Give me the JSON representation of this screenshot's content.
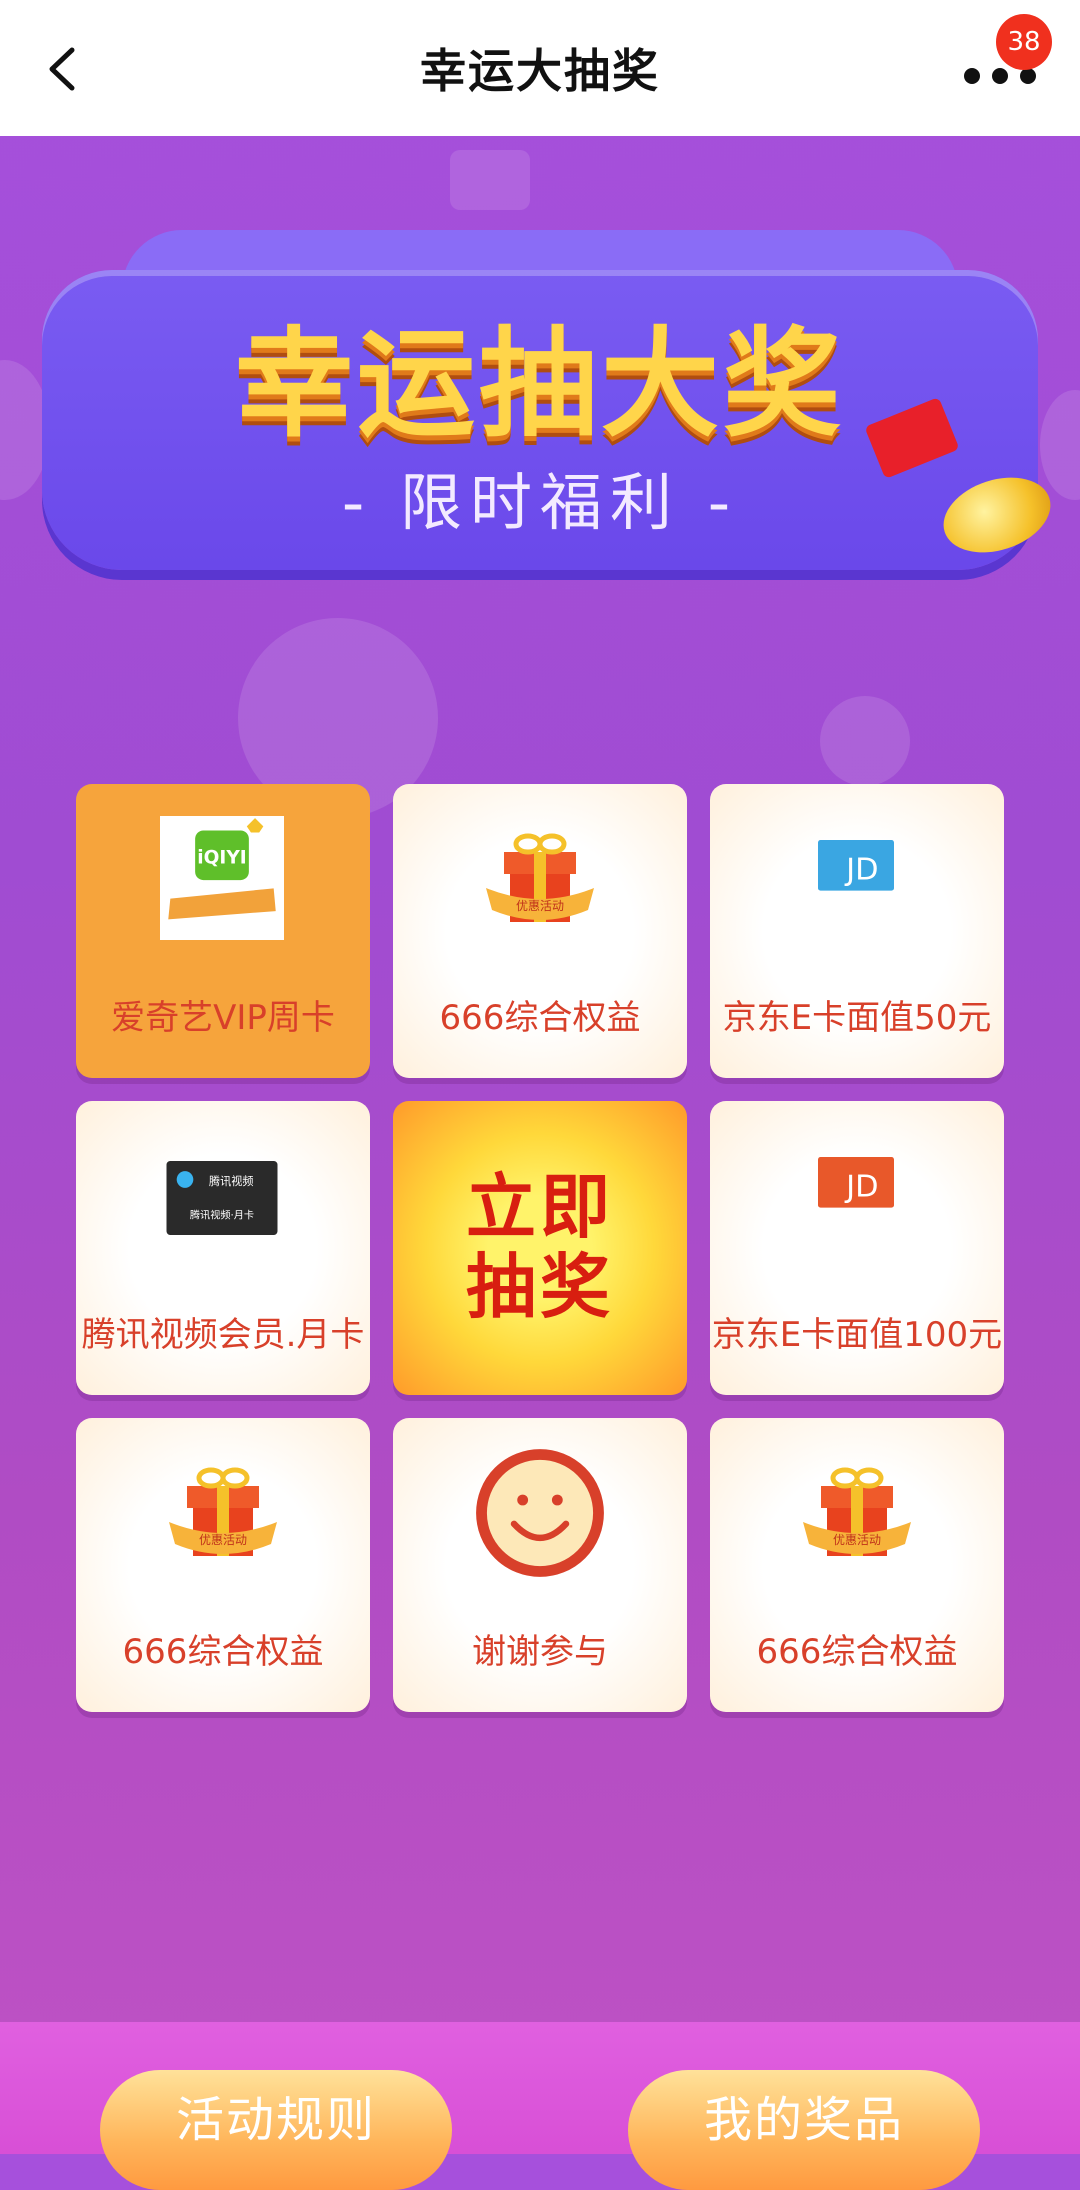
{
  "nav": {
    "title": "幸运大抽奖",
    "badge": "38"
  },
  "banner": {
    "title": "幸运抽大奖",
    "subtitle": "- 限时福利 -"
  },
  "grid": {
    "cells": [
      {
        "label": "爱奇艺VIP周卡",
        "icon": "iqiyi-card-icon",
        "selected": true
      },
      {
        "label": "666综合权益",
        "icon": "gift-box-icon"
      },
      {
        "label": "京东E卡面值50元",
        "icon": "jd-card-blue-icon"
      },
      {
        "label": "腾讯视频会员.月卡",
        "icon": "tencent-video-card-icon"
      },
      {
        "label": "京东E卡面值100元",
        "icon": "jd-card-orange-icon"
      },
      {
        "label": "666综合权益",
        "icon": "gift-box-icon"
      },
      {
        "label": "谢谢参与",
        "icon": "smiley-icon"
      },
      {
        "label": "666综合权益",
        "icon": "gift-box-icon"
      }
    ],
    "draw_button": {
      "line1": "立即",
      "line2": "抽奖"
    },
    "gift_ribbon_text": "优惠活动",
    "iqiyi_logo": "iQIYI",
    "tencent_card_text": "腾讯视频·月卡",
    "tencent_logo_text": "腾讯视频"
  },
  "bottom": {
    "rules_label": "活动规则",
    "prizes_label": "我的奖品"
  },
  "colors": {
    "accent_red": "#d8402a",
    "selected_orange": "#f6a43c",
    "badge_red": "#f0301e"
  }
}
